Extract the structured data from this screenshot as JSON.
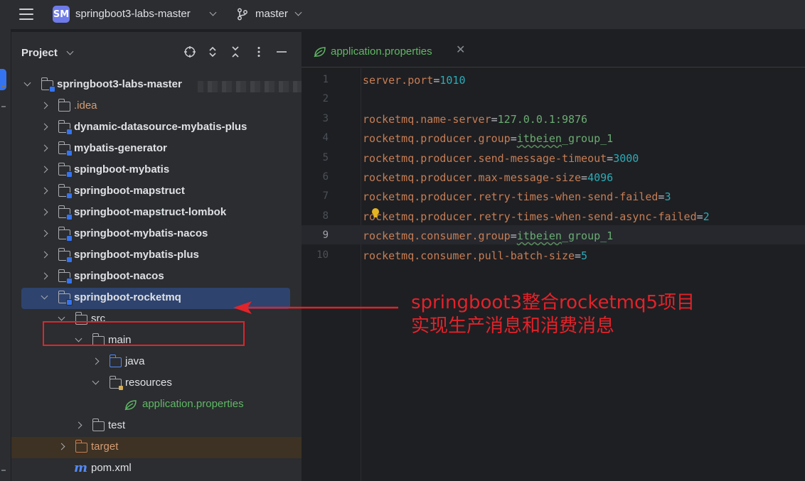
{
  "topbar": {
    "project_badge": "SM",
    "project_name": "springboot3-labs-master",
    "branch": "master"
  },
  "panel": {
    "title": "Project"
  },
  "tree": [
    {
      "label": "springboot3-labs-master",
      "depth": 0,
      "expanded": true,
      "style": "bold",
      "icon": "module-folder-icon"
    },
    {
      "label": ".idea",
      "depth": 1,
      "expanded": false,
      "style": "idea",
      "icon": "folder-icon"
    },
    {
      "label": "dynamic-datasource-mybatis-plus",
      "depth": 1,
      "expanded": false,
      "style": "bold",
      "icon": "module-folder-icon"
    },
    {
      "label": "mybatis-generator",
      "depth": 1,
      "expanded": false,
      "style": "bold",
      "icon": "module-folder-icon"
    },
    {
      "label": "spingboot-mybatis",
      "depth": 1,
      "expanded": false,
      "style": "bold",
      "icon": "module-folder-icon"
    },
    {
      "label": "springboot-mapstruct",
      "depth": 1,
      "expanded": false,
      "style": "bold",
      "icon": "module-folder-icon"
    },
    {
      "label": "springboot-mapstruct-lombok",
      "depth": 1,
      "expanded": false,
      "style": "bold",
      "icon": "module-folder-icon"
    },
    {
      "label": "springboot-mybatis-nacos",
      "depth": 1,
      "expanded": false,
      "style": "bold",
      "icon": "module-folder-icon"
    },
    {
      "label": "springboot-mybatis-plus",
      "depth": 1,
      "expanded": false,
      "style": "bold",
      "icon": "module-folder-icon"
    },
    {
      "label": "springboot-nacos",
      "depth": 1,
      "expanded": false,
      "style": "bold",
      "icon": "module-folder-icon"
    },
    {
      "label": "springboot-rocketmq",
      "depth": 1,
      "expanded": true,
      "style": "bold",
      "icon": "module-folder-icon",
      "selected": true
    },
    {
      "label": "src",
      "depth": 2,
      "expanded": true,
      "style": "plain",
      "icon": "folder-icon"
    },
    {
      "label": "main",
      "depth": 3,
      "expanded": true,
      "style": "plain",
      "icon": "folder-icon"
    },
    {
      "label": "java",
      "depth": 4,
      "expanded": false,
      "style": "plain",
      "icon": "source-folder-icon"
    },
    {
      "label": "resources",
      "depth": 4,
      "expanded": true,
      "style": "plain",
      "icon": "resources-folder-icon"
    },
    {
      "label": "application.properties",
      "depth": 5,
      "style": "green",
      "icon": "spring-leaf-icon"
    },
    {
      "label": "test",
      "depth": 3,
      "expanded": false,
      "style": "plain",
      "icon": "folder-icon"
    },
    {
      "label": "target",
      "depth": 2,
      "expanded": false,
      "style": "orange",
      "icon": "excluded-folder-icon",
      "excluded": true
    },
    {
      "label": "pom.xml",
      "depth": 2,
      "style": "plain",
      "icon": "maven-icon"
    }
  ],
  "editor": {
    "tab_label": "application.properties",
    "current_line": 9,
    "lines": [
      {
        "n": "1",
        "key": "server.port",
        "value": "1010",
        "type": "num"
      },
      {
        "n": "2",
        "key": "",
        "value": "",
        "type": "empty"
      },
      {
        "n": "3",
        "key": "rocketmq.name-server",
        "value": "127.0.0.1:9876",
        "type": "str"
      },
      {
        "n": "4",
        "key": "rocketmq.producer.group",
        "value": "itbeien_group_1",
        "type": "str-u"
      },
      {
        "n": "5",
        "key": "rocketmq.producer.send-message-timeout",
        "value": "3000",
        "type": "num"
      },
      {
        "n": "6",
        "key": "rocketmq.producer.max-message-size",
        "value": "4096",
        "type": "num"
      },
      {
        "n": "7",
        "key": "rocketmq.producer.retry-times-when-send-failed",
        "value": "3",
        "type": "num"
      },
      {
        "n": "8",
        "key": "rocketmq.producer.retry-times-when-send-async-failed",
        "value": "2",
        "type": "num"
      },
      {
        "n": "9",
        "key": "rocketmq.consumer.group",
        "value": "itbeien_group_1",
        "type": "str-u"
      },
      {
        "n": "10",
        "key": "rocketmq.consumer.pull-batch-size",
        "value": "5",
        "type": "num"
      }
    ]
  },
  "annotation": {
    "line1": "springboot3整合rocketmq5项目",
    "line2": "实现生产消息和消费消息"
  }
}
